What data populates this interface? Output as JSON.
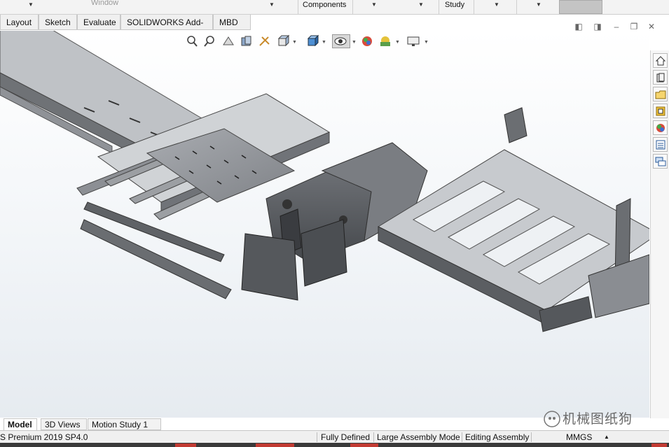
{
  "menu": {
    "window_label": "Window",
    "components_label": "Components",
    "study_label": "Study"
  },
  "tabs": [
    {
      "label": "Layout"
    },
    {
      "label": "Sketch"
    },
    {
      "label": "Evaluate"
    },
    {
      "label": "SOLIDWORKS Add-Ins"
    },
    {
      "label": "MBD"
    }
  ],
  "heads_up_toolbar": {
    "icons": [
      "zoom-to-fit-icon",
      "zoom-to-area-icon",
      "previous-view-icon",
      "section-view-icon",
      "dynamic-annotation-icon",
      "view-orientation-icon",
      "display-style-icon",
      "hide-show-items-icon",
      "edit-appearance-icon",
      "apply-scene-icon",
      "view-settings-icon"
    ]
  },
  "task_pane": {
    "icons": [
      "home-icon",
      "resources-icon",
      "design-library-icon",
      "file-explorer-icon",
      "appearances-icon",
      "custom-properties-icon",
      "forum-icon"
    ]
  },
  "bottom_tabs": [
    {
      "label": "Model",
      "active": true
    },
    {
      "label": "3D Views",
      "active": false
    },
    {
      "label": "Motion Study 1",
      "active": false
    }
  ],
  "status": {
    "version": "S Premium 2019 SP4.0",
    "fully_defined": "Fully Defined",
    "large_assembly": "Large Assembly Mode",
    "editing": "Editing Assembly",
    "units": "MMGS"
  },
  "watermark": {
    "text": "机械图纸狗"
  },
  "colors": {
    "accent_red": "#c23b33",
    "model_gray": "#8a8d92"
  }
}
